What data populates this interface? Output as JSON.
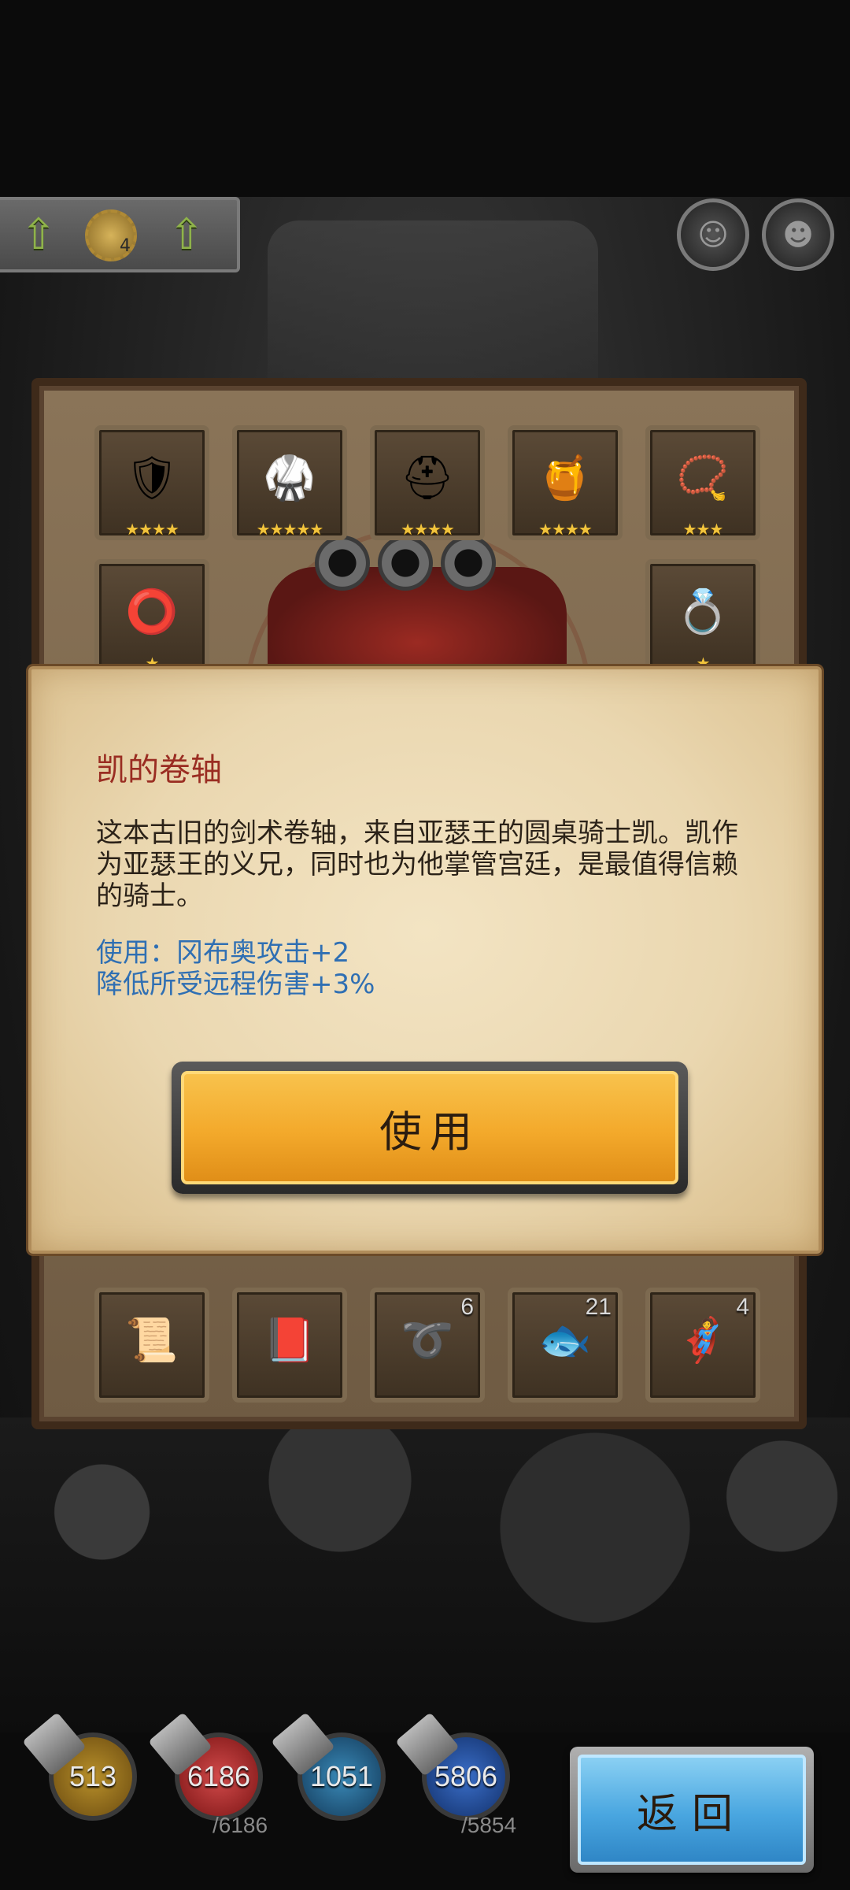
{
  "upgrade_bar": {
    "gear_count": "4"
  },
  "inventory": {
    "top_row": [
      {
        "icon": "shoulder-armor-icon",
        "stars": "★★★★"
      },
      {
        "icon": "chest-armor-icon",
        "stars": "★★★★★"
      },
      {
        "icon": "helmet-icon",
        "stars": "★★★★"
      },
      {
        "icon": "cauldron-icon",
        "stars": "★★★★"
      },
      {
        "icon": "amulet-icon",
        "stars": "★★★"
      }
    ],
    "second_row": [
      {
        "icon": "green-bracelet-icon",
        "stars": "★"
      },
      {
        "icon": "blue-ring-icon",
        "stars": "★"
      }
    ],
    "bottom_row": [
      {
        "icon": "scroll-gold-icon",
        "count": ""
      },
      {
        "icon": "scroll-red-icon",
        "count": ""
      },
      {
        "icon": "whip-icon",
        "count": "6"
      },
      {
        "icon": "slime-pet-icon",
        "count": "21"
      },
      {
        "icon": "hero-card-icon",
        "count": "4"
      }
    ]
  },
  "dialog": {
    "title": "凯的卷轴",
    "description": "这本古旧的剑术卷轴，来自亚瑟王的圆桌骑士凯。凯作为亚瑟王的义兄，同时也为他掌管宫廷，是最值得信赖的骑士。",
    "effect_line1": "使用：冈布奥攻击+2",
    "effect_line2": "降低所受远程伤害+3%",
    "use_button": "使用"
  },
  "resources": {
    "attack": "513",
    "hp": "6186",
    "hp_max": "/6186",
    "defense": "1051",
    "mana": "5806",
    "mana_max": "/5854"
  },
  "back_button": "返回",
  "colors": {
    "title_red": "#9a2d22",
    "effect_blue": "#2f6fb3",
    "use_button_gold": "#f3a92b",
    "back_button_blue": "#49a6e0"
  }
}
